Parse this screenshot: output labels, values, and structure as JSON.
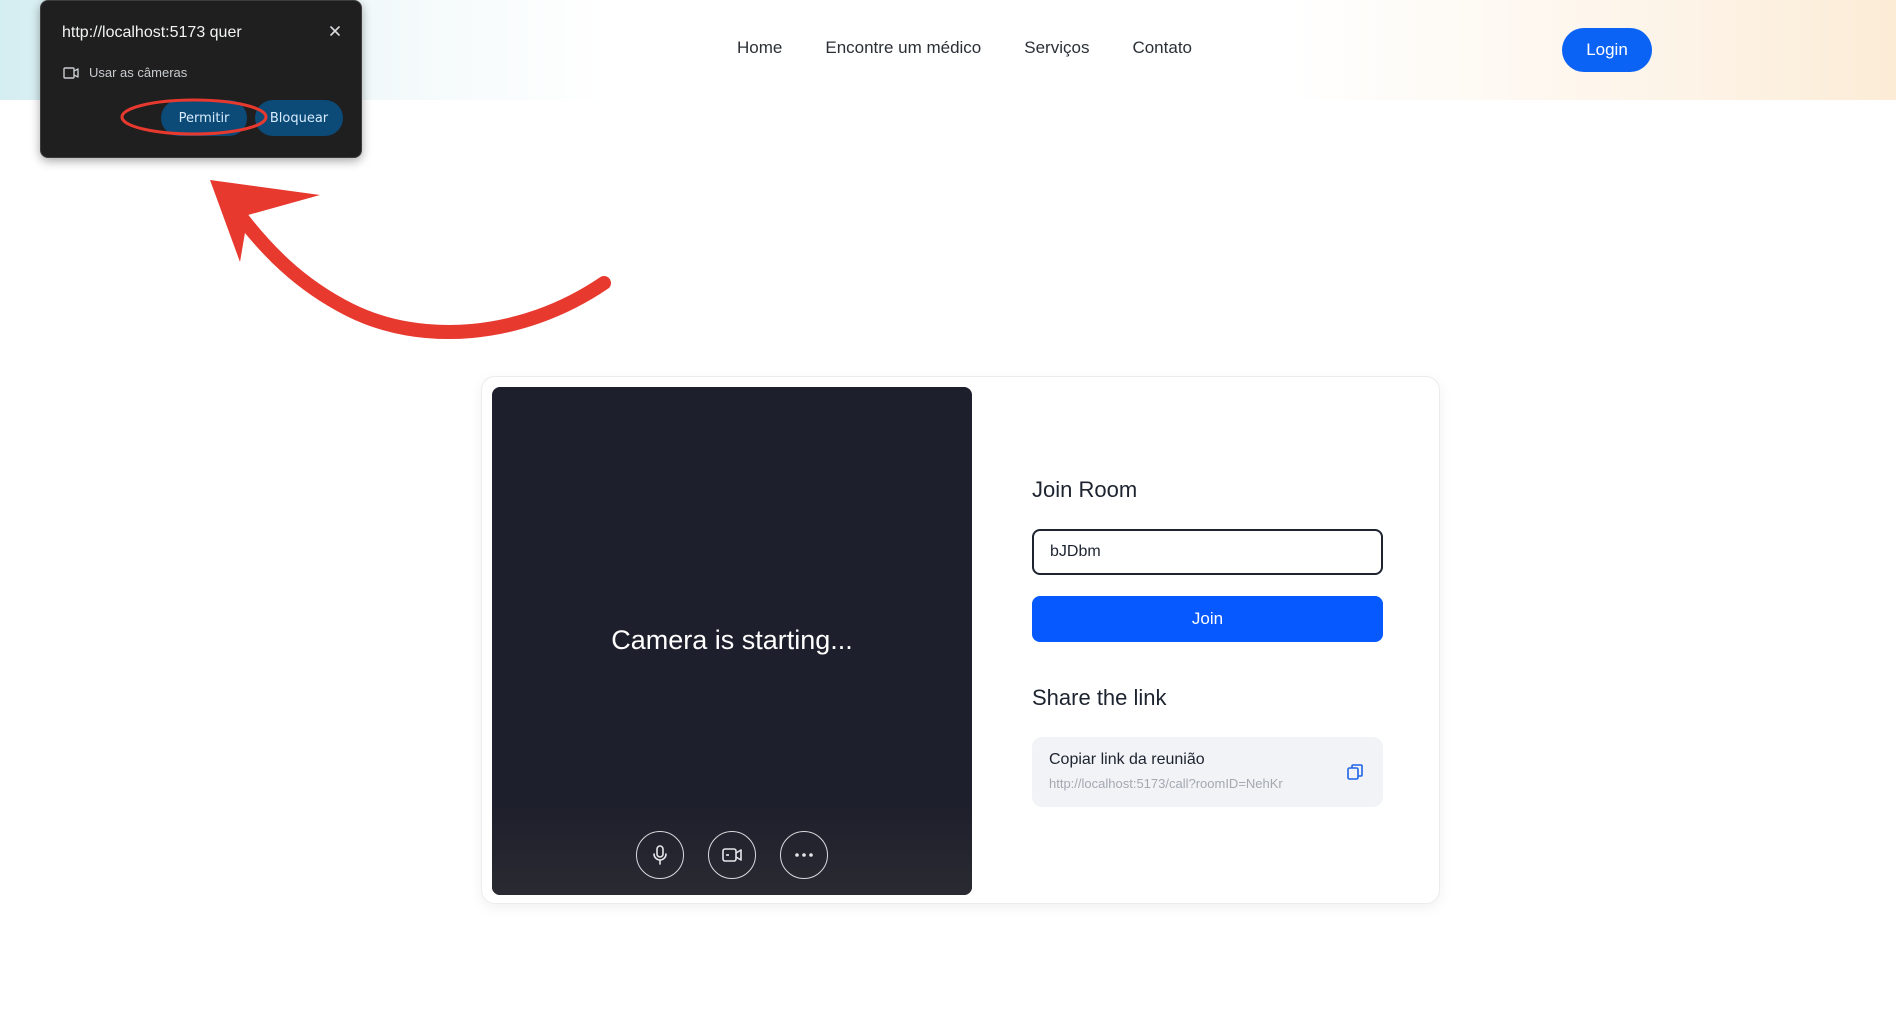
{
  "header": {
    "nav": [
      "Home",
      "Encontre um médico",
      "Serviços",
      "Contato"
    ],
    "login_label": "Login"
  },
  "permission_popup": {
    "title": "http://localhost:5173 quer",
    "permission_text": "Usar as câmeras",
    "allow_label": "Permitir",
    "block_label": "Bloquear"
  },
  "video": {
    "status_text": "Camera is starting..."
  },
  "join": {
    "title": "Join Room",
    "room_value": "bJDbm",
    "join_label": "Join"
  },
  "share": {
    "title": "Share the link",
    "copy_label": "Copiar link da reunião",
    "url": "http://localhost:5173/call?roomID=NehKr"
  },
  "colors": {
    "accent": "#0559ff",
    "login": "#0b63f6",
    "annotation": "#e8392f",
    "video_bg": "#1e1f2c"
  },
  "icons": [
    "close-icon",
    "camera-icon",
    "microphone-icon",
    "video-camera-icon",
    "more-icon",
    "copy-icon"
  ]
}
